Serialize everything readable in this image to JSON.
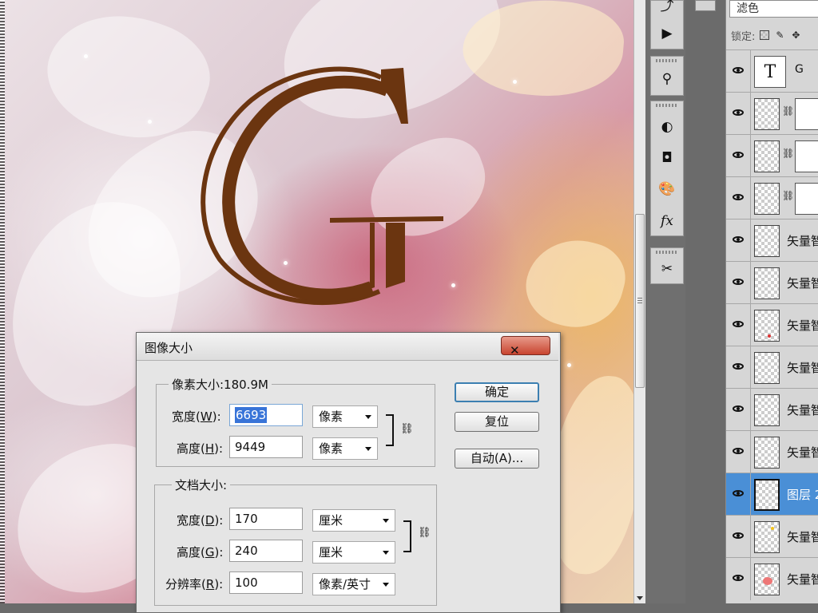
{
  "canvas": {
    "letter": "G",
    "letter_color": "#6b3510"
  },
  "tools": [
    {
      "name": "history-brush-icon",
      "glyph": "⤴"
    },
    {
      "name": "actions-play-icon",
      "glyph": "▶"
    },
    {
      "name": "clone-source-icon",
      "glyph": "⚲"
    },
    {
      "name": "adjustments-icon",
      "glyph": "◐"
    },
    {
      "name": "masks-icon",
      "glyph": "◘"
    },
    {
      "name": "styles-palette-icon",
      "glyph": "🎨"
    },
    {
      "name": "fx-icon",
      "glyph": "fx"
    },
    {
      "name": "tools-scissors-icon",
      "glyph": "✂"
    }
  ],
  "layers_panel": {
    "blend_mode": "滤色",
    "lock_label": "锁定:",
    "layers": [
      {
        "name": "G",
        "type": "text",
        "visible": true
      },
      {
        "name": "",
        "type": "masked",
        "visible": true
      },
      {
        "name": "",
        "type": "masked",
        "visible": true
      },
      {
        "name": "",
        "type": "masked",
        "visible": true
      },
      {
        "name": "矢量智",
        "type": "normal",
        "visible": true
      },
      {
        "name": "矢量智",
        "type": "normal",
        "visible": true
      },
      {
        "name": "矢量智",
        "type": "normal",
        "visible": true
      },
      {
        "name": "矢量智",
        "type": "normal",
        "visible": true
      },
      {
        "name": "矢量智",
        "type": "normal",
        "visible": true
      },
      {
        "name": "矢量智",
        "type": "normal",
        "visible": true
      },
      {
        "name": "图层 2",
        "type": "normal",
        "visible": true,
        "selected": true
      },
      {
        "name": "矢量智",
        "type": "normal",
        "visible": true
      },
      {
        "name": "矢量智",
        "type": "normal",
        "visible": true
      }
    ]
  },
  "dialog": {
    "title": "图像大小",
    "close_glyph": "✕",
    "pixel_group_label": "像素大小:180.9M",
    "doc_group_label": "文档大小:",
    "pixel": {
      "width_label": "宽度",
      "width_key": "W",
      "width_value": "6693",
      "width_unit": "像素",
      "height_label": "高度",
      "height_key": "H",
      "height_value": "9449",
      "height_unit": "像素"
    },
    "document": {
      "width_label": "宽度",
      "width_key": "D",
      "width_value": "170",
      "width_unit": "厘米",
      "height_label": "高度",
      "height_key": "G",
      "height_value": "240",
      "height_unit": "厘米",
      "resolution_label": "分辨率",
      "resolution_key": "R",
      "resolution_value": "100",
      "resolution_unit": "像素/英寸"
    },
    "buttons": {
      "ok": "确定",
      "reset": "复位",
      "auto": "自动(A)..."
    }
  }
}
